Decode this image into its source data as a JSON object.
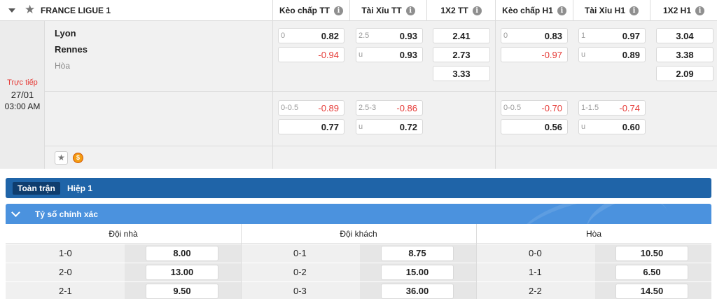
{
  "header": {
    "league": "FRANCE LIGUE 1",
    "columns": [
      "Kèo chấp TT",
      "Tài Xỉu TT",
      "1X2 TT",
      "Kèo chấp H1",
      "Tài Xỉu H1",
      "1X2 H1"
    ],
    "info_icon": "i"
  },
  "match": {
    "status": "Trực tiếp",
    "date": "27/01",
    "time": "03:00 AM",
    "home": "Lyon",
    "away": "Rennes",
    "draw": "Hòa",
    "row1": {
      "hdp_tt": [
        {
          "pre": "0",
          "val": "0.82",
          "neg": false
        },
        {
          "pre": "",
          "val": "-0.94",
          "neg": true
        }
      ],
      "ou_tt": [
        {
          "pre": "2.5",
          "val": "0.93",
          "neg": false
        },
        {
          "pre": "u",
          "val": "0.93",
          "neg": false
        }
      ],
      "x12_tt": [
        "2.41",
        "2.73",
        "3.33"
      ],
      "hdp_h1": [
        {
          "pre": "0",
          "val": "0.83",
          "neg": false
        },
        {
          "pre": "",
          "val": "-0.97",
          "neg": true
        }
      ],
      "ou_h1": [
        {
          "pre": "1",
          "val": "0.97",
          "neg": false
        },
        {
          "pre": "u",
          "val": "0.89",
          "neg": false
        }
      ],
      "x12_h1": [
        "3.04",
        "3.38",
        "2.09"
      ]
    },
    "row2": {
      "hdp_tt": [
        {
          "pre": "0-0.5",
          "val": "-0.89",
          "neg": true
        },
        {
          "pre": "",
          "val": "0.77",
          "neg": false
        }
      ],
      "ou_tt": [
        {
          "pre": "2.5-3",
          "val": "-0.86",
          "neg": true
        },
        {
          "pre": "u",
          "val": "0.72",
          "neg": false
        }
      ],
      "hdp_h1": [
        {
          "pre": "0-0.5",
          "val": "-0.70",
          "neg": true
        },
        {
          "pre": "",
          "val": "0.56",
          "neg": false
        }
      ],
      "ou_h1": [
        {
          "pre": "1-1.5",
          "val": "-0.74",
          "neg": true
        },
        {
          "pre": "u",
          "val": "0.60",
          "neg": false
        }
      ]
    },
    "favorite_icon": "★",
    "tipico_icon": "$"
  },
  "tabs": {
    "active": "Toàn trận",
    "other": "Hiệp 1"
  },
  "correct_score": {
    "title": "Tỷ số chính xác",
    "columns": [
      "Đội nhà",
      "Đội khách",
      "Hòa"
    ],
    "home": [
      {
        "score": "1-0",
        "odd": "8.00"
      },
      {
        "score": "2-0",
        "odd": "13.00"
      },
      {
        "score": "2-1",
        "odd": "9.50"
      }
    ],
    "away": [
      {
        "score": "0-1",
        "odd": "8.75"
      },
      {
        "score": "0-2",
        "odd": "15.00"
      },
      {
        "score": "0-3",
        "odd": "36.00"
      }
    ],
    "draw": [
      {
        "score": "0-0",
        "odd": "10.50"
      },
      {
        "score": "1-1",
        "odd": "6.50"
      },
      {
        "score": "2-2",
        "odd": "14.50"
      }
    ]
  },
  "colors": {
    "live": "#e53935",
    "negative": "#e53935",
    "tab_bar": "#1f64a8",
    "section_bar": "#4b92de"
  }
}
